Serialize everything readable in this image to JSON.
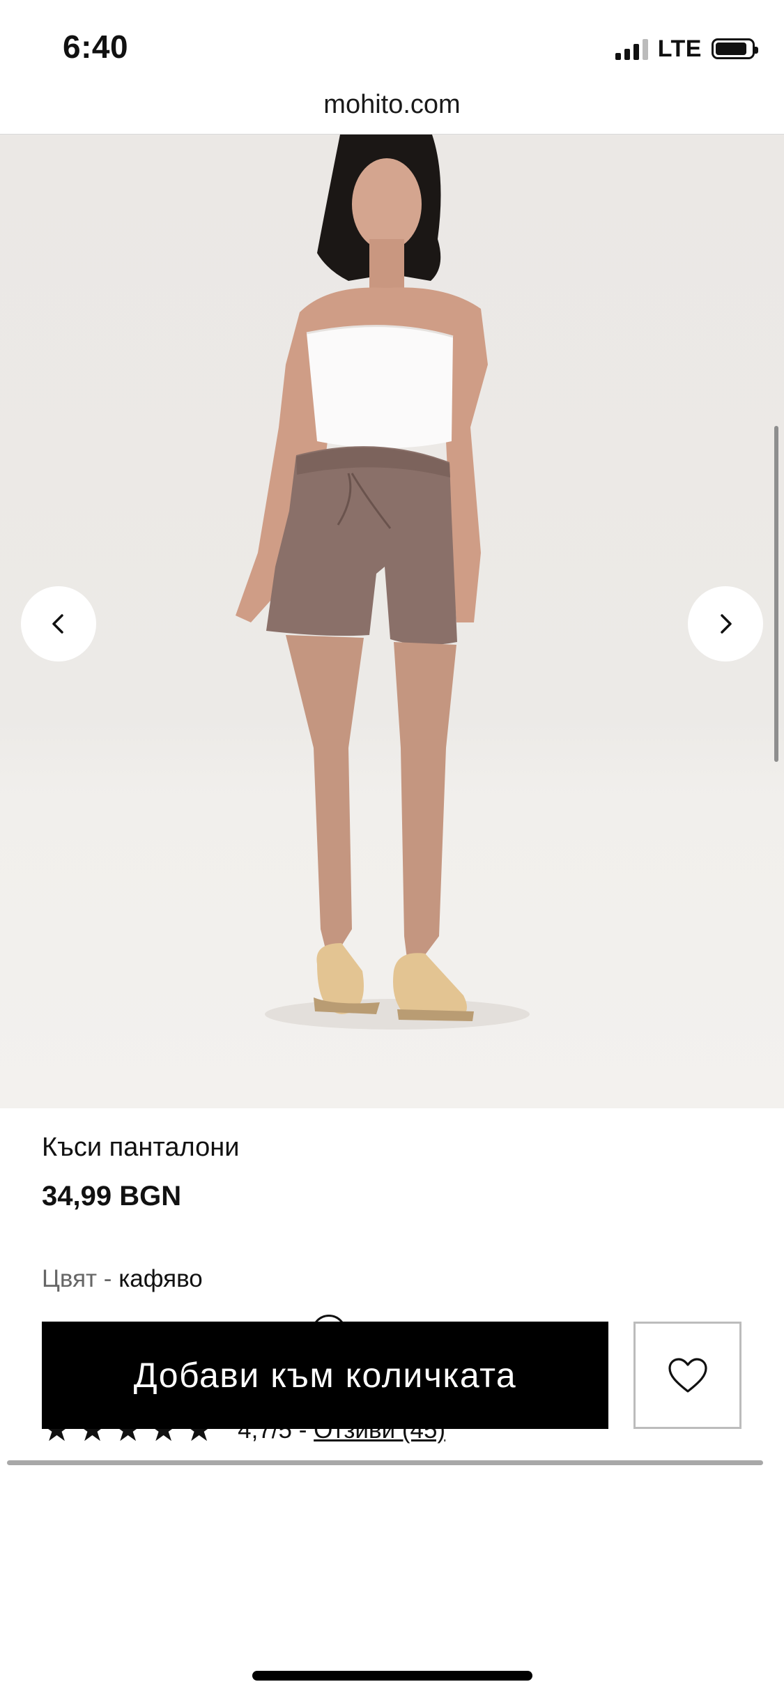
{
  "status_bar": {
    "time": "6:40",
    "network": "LTE"
  },
  "browser": {
    "url": "mohito.com"
  },
  "gallery": {
    "prev_icon": "chevron-left-icon",
    "next_icon": "chevron-right-icon"
  },
  "product": {
    "name": "Къси панталони",
    "price": "34,99 BGN",
    "color_label": "Цвят",
    "color_separator": " - ",
    "color_value": "кафяво",
    "rating_value": "4,7/5",
    "rating_separator": " - ",
    "reviews_label": "Отзиви (45)",
    "stars": 5
  },
  "actions": {
    "add_to_cart": "Добави към количката",
    "wishlist_icon": "heart-icon"
  },
  "colors": {
    "button_bg": "#000000",
    "shorts": "#8a7069",
    "background": "#ebe8e5"
  }
}
